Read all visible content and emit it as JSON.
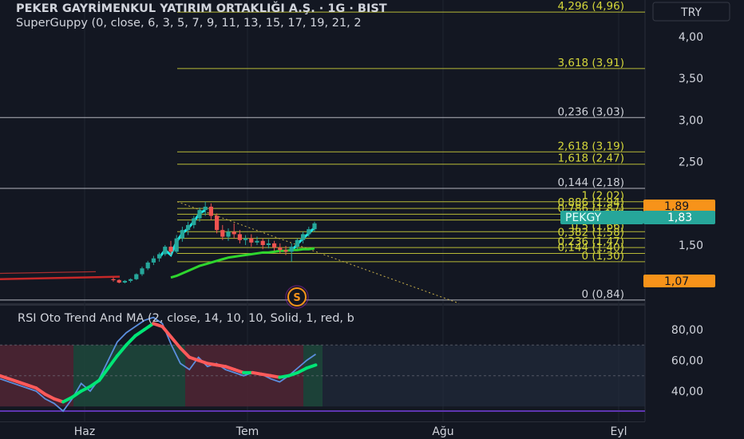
{
  "header": {
    "title": "PEKER GAYRİMENKUL YATIRIM ORTAKLIĞI A.Ş. · 1G · BIST",
    "indicator": "SuperGuppy (0, close, 6, 3, 5, 7, 9, 11, 13, 15, 17, 19, 21, 2",
    "currency": "TRY"
  },
  "rsi_panel": {
    "title": "RSI Oto Trend And MA (2, close, 14, 10, 10, Solid, 1, red, b"
  },
  "colors": {
    "background": "#131722",
    "fib_yellow": "#d4d63a",
    "fib_white": "#cfd2d9",
    "bull": "#26a69a",
    "bear": "#ef5350",
    "guppy_cyan": "#1de9e6",
    "guppy_green": "#2ed62e",
    "price_tag": "#26a69a",
    "orange_tag": "#f7931a",
    "rsi_blue": "#5b8ede",
    "rsi_ma_red": "#ff5a5a",
    "rsi_ma_green": "#00e676"
  },
  "badges": {
    "ticker": "PEKGY",
    "ticker_price": "1,83",
    "tag_high": "1,89",
    "tag_low": "1,07",
    "marker": "S"
  },
  "chart_data": [
    {
      "type": "candlestick",
      "title": "PEKER GAYRİMENKUL YATIRIM ORTAKLIĞI A.Ş. · 1G · BIST",
      "y_axis_labels": [
        "4,00",
        "3,50",
        "3,00",
        "2,50",
        "1,50"
      ],
      "ylim": [
        0.8,
        4.4
      ],
      "x_axis_labels": [
        "Haz",
        "Tem",
        "Ağu",
        "Eyl"
      ],
      "fib_levels": [
        {
          "label": "4,296 (4,96)",
          "value": 4.296,
          "color": "yellow"
        },
        {
          "label": "3,618 (3,91)",
          "value": 3.618,
          "color": "yellow"
        },
        {
          "label": "2,618 (3,19)",
          "value": 2.618,
          "color": "yellow"
        },
        {
          "label": "0,236 (3,03)",
          "value": 3.03,
          "color": "white"
        },
        {
          "label": "1,618 (2,47)",
          "value": 2.47,
          "color": "yellow"
        },
        {
          "label": "0,144 (2,18)",
          "value": 2.18,
          "color": "white"
        },
        {
          "label": "1 (2,02)",
          "value": 2.02,
          "color": "yellow"
        },
        {
          "label": "0,886 (1,94)",
          "value": 1.94,
          "color": "yellow"
        },
        {
          "label": "0,786 (1,87)",
          "value": 1.87,
          "color": "yellow"
        },
        {
          "label": "0,618",
          "value": 1.8,
          "color": "yellow"
        },
        {
          "label": "0,5 (1,66)",
          "value": 1.66,
          "color": "yellow"
        },
        {
          "label": "0,382 (1,58)",
          "value": 1.58,
          "color": "yellow"
        },
        {
          "label": "0,236 (1,47)",
          "value": 1.47,
          "color": "yellow"
        },
        {
          "label": "0,144 (1,40)",
          "value": 1.4,
          "color": "yellow"
        },
        {
          "label": "0 (1,30)",
          "value": 1.3,
          "color": "yellow"
        },
        {
          "label": "0 (0,84)",
          "value": 0.84,
          "color": "white"
        }
      ],
      "candles": [
        [
          0,
          1.09,
          1.11,
          1.06,
          1.08
        ],
        [
          1,
          1.08,
          1.09,
          1.04,
          1.05
        ],
        [
          2,
          1.05,
          1.08,
          1.04,
          1.07
        ],
        [
          3,
          1.07,
          1.1,
          1.05,
          1.09
        ],
        [
          4,
          1.09,
          1.16,
          1.08,
          1.15
        ],
        [
          5,
          1.15,
          1.24,
          1.13,
          1.22
        ],
        [
          6,
          1.22,
          1.31,
          1.2,
          1.29
        ],
        [
          7,
          1.29,
          1.37,
          1.26,
          1.34
        ],
        [
          8,
          1.34,
          1.41,
          1.3,
          1.39
        ],
        [
          9,
          1.39,
          1.5,
          1.37,
          1.48
        ],
        [
          10,
          1.48,
          1.55,
          1.38,
          1.42
        ],
        [
          11,
          1.42,
          1.62,
          1.4,
          1.58
        ],
        [
          12,
          1.58,
          1.72,
          1.54,
          1.68
        ],
        [
          13,
          1.68,
          1.78,
          1.62,
          1.74
        ],
        [
          14,
          1.74,
          1.85,
          1.7,
          1.82
        ],
        [
          15,
          1.82,
          1.95,
          1.78,
          1.92
        ],
        [
          16,
          1.92,
          2.02,
          1.85,
          1.96
        ],
        [
          17,
          1.96,
          2.0,
          1.8,
          1.85
        ],
        [
          18,
          1.85,
          1.88,
          1.64,
          1.68
        ],
        [
          19,
          1.68,
          1.74,
          1.56,
          1.6
        ],
        [
          20,
          1.6,
          1.7,
          1.55,
          1.66
        ],
        [
          21,
          1.66,
          1.76,
          1.58,
          1.63
        ],
        [
          22,
          1.63,
          1.68,
          1.52,
          1.56
        ],
        [
          23,
          1.56,
          1.62,
          1.5,
          1.58
        ],
        [
          24,
          1.58,
          1.63,
          1.48,
          1.53
        ],
        [
          25,
          1.53,
          1.6,
          1.5,
          1.55
        ],
        [
          26,
          1.55,
          1.58,
          1.45,
          1.5
        ],
        [
          27,
          1.5,
          1.57,
          1.46,
          1.52
        ],
        [
          28,
          1.52,
          1.55,
          1.43,
          1.47
        ],
        [
          29,
          1.47,
          1.52,
          1.4,
          1.44
        ],
        [
          30,
          1.44,
          1.49,
          1.38,
          1.42
        ],
        [
          31,
          1.42,
          1.52,
          1.3,
          1.48
        ],
        [
          32,
          1.48,
          1.58,
          1.45,
          1.56
        ],
        [
          33,
          1.56,
          1.66,
          1.52,
          1.63
        ],
        [
          34,
          1.63,
          1.72,
          1.6,
          1.69
        ],
        [
          35,
          1.69,
          1.78,
          1.66,
          1.76
        ]
      ]
    },
    {
      "type": "line",
      "title": "RSI Oto Trend And MA (2, close, 14, 10, 10, Solid, 1, red, b",
      "y_axis_labels": [
        "80,00",
        "60,00",
        "40,00"
      ],
      "ylim": [
        18,
        100
      ],
      "series": [
        {
          "values": [
            48,
            46,
            44,
            42,
            40,
            35,
            32,
            27,
            35,
            45,
            40,
            48,
            60,
            72,
            78,
            82,
            86,
            88,
            84,
            70,
            58,
            54,
            62,
            56,
            58,
            54,
            52,
            50,
            52,
            51,
            48,
            46,
            50,
            55,
            60,
            64
          ]
        },
        {
          "values": [
            50,
            48,
            46,
            44,
            42,
            38,
            35,
            33,
            36,
            40,
            43,
            47,
            55,
            63,
            70,
            76,
            80,
            84,
            82,
            75,
            68,
            62,
            60,
            58,
            57,
            56,
            54,
            52,
            52,
            51,
            50,
            49,
            50,
            52,
            55,
            57
          ]
        }
      ]
    }
  ]
}
